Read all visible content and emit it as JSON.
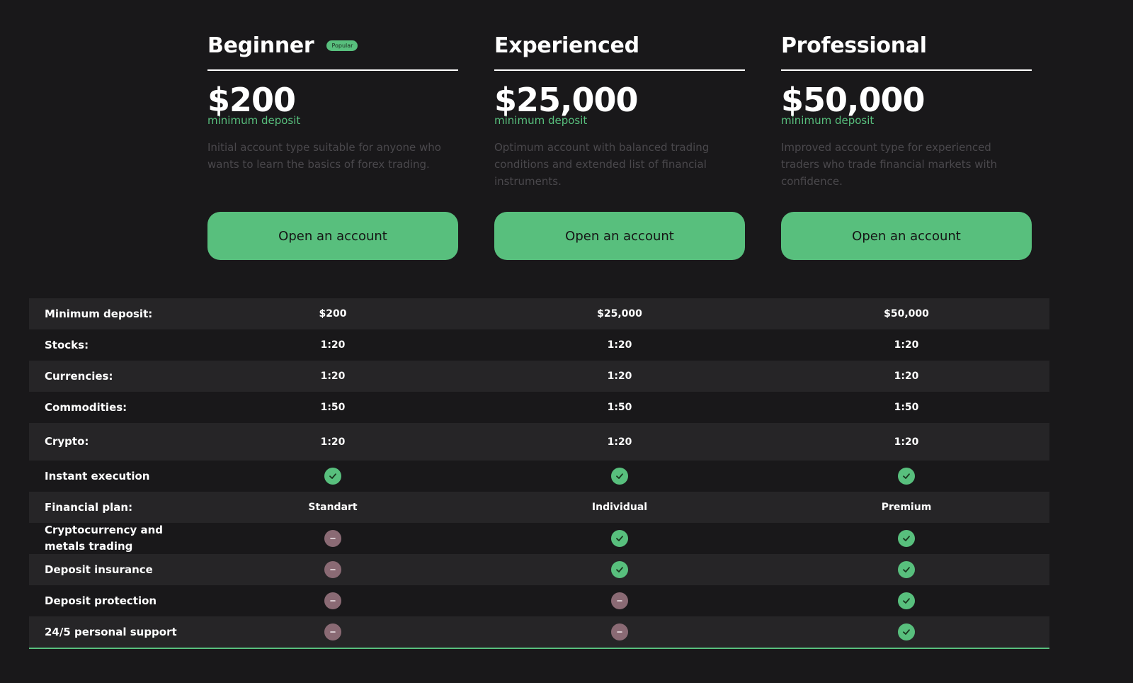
{
  "plans": [
    {
      "title": "Beginner",
      "badge": "Popular",
      "price": "$200",
      "price_sub": "minimum deposit",
      "description": "Initial account type suitable for anyone who wants to learn the basics of forex trading.",
      "button": "Open an account"
    },
    {
      "title": "Experienced",
      "badge": "",
      "price": "$25,000",
      "price_sub": "minimum deposit",
      "description": "Optimum account with balanced trading conditions and extended list of financial instruments.",
      "button": "Open an account"
    },
    {
      "title": "Professional",
      "badge": "",
      "price": "$50,000",
      "price_sub": "minimum deposit",
      "description": "Improved account type for experienced traders who trade financial markets with confidence.",
      "button": "Open an account"
    }
  ],
  "table": {
    "rows": [
      {
        "label": "Minimum deposit:",
        "values": [
          {
            "text": "$200"
          },
          {
            "text": "$25,000"
          },
          {
            "text": "$50,000"
          }
        ]
      },
      {
        "label": "Stocks:",
        "values": [
          {
            "text": "1:20"
          },
          {
            "text": "1:20"
          },
          {
            "text": "1:20"
          }
        ]
      },
      {
        "label": "Currencies:",
        "values": [
          {
            "text": "1:20"
          },
          {
            "text": "1:20"
          },
          {
            "text": "1:20"
          }
        ]
      },
      {
        "label": "Commodities:",
        "values": [
          {
            "text": "1:50"
          },
          {
            "text": "1:50"
          },
          {
            "text": "1:50"
          }
        ]
      },
      {
        "label": "Crypto:",
        "values": [
          {
            "text": "1:20"
          },
          {
            "text": "1:20"
          },
          {
            "text": "1:20"
          }
        ]
      },
      {
        "label": "Instant execution",
        "values": [
          {
            "icon": "check-icon"
          },
          {
            "icon": "check-icon"
          },
          {
            "icon": "check-icon"
          }
        ]
      },
      {
        "label": "Financial plan:",
        "values": [
          {
            "text": "Standart"
          },
          {
            "text": "Individual"
          },
          {
            "text": "Premium"
          }
        ]
      },
      {
        "label": "Cryptocurrency and metals trading",
        "values": [
          {
            "icon": "minus-icon"
          },
          {
            "icon": "check-icon"
          },
          {
            "icon": "check-icon"
          }
        ]
      },
      {
        "label": "Deposit insurance",
        "values": [
          {
            "icon": "minus-icon"
          },
          {
            "icon": "check-icon"
          },
          {
            "icon": "check-icon"
          }
        ]
      },
      {
        "label": "Deposit protection",
        "values": [
          {
            "icon": "minus-icon"
          },
          {
            "icon": "minus-icon"
          },
          {
            "icon": "check-icon"
          }
        ]
      },
      {
        "label": "24/5 personal support",
        "values": [
          {
            "icon": "minus-icon"
          },
          {
            "icon": "minus-icon"
          },
          {
            "icon": "check-icon"
          }
        ]
      }
    ]
  },
  "colors": {
    "background": "#19181a",
    "accent": "#58bf7d",
    "row_shade": "#262527",
    "negative": "#8a6a74",
    "muted_text": "#4a484c"
  }
}
